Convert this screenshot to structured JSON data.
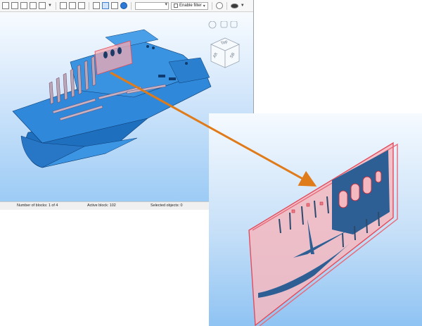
{
  "toolbar": {
    "filter_label": "Enable filter",
    "combo_value": ""
  },
  "viewcube": {
    "face_top": "Top",
    "face_left": "Aft",
    "face_right": "SB"
  },
  "status": {
    "blocks": "Number of blocks: 1 of 4",
    "active_block": "Active block: 102",
    "selected": "Selected objects: 0"
  },
  "colors": {
    "hull_blue": "#2f88d9",
    "highlight_pink": "#f07a85",
    "callout_arrow": "#e07b1a",
    "background_sky": "#a8d0f5"
  }
}
